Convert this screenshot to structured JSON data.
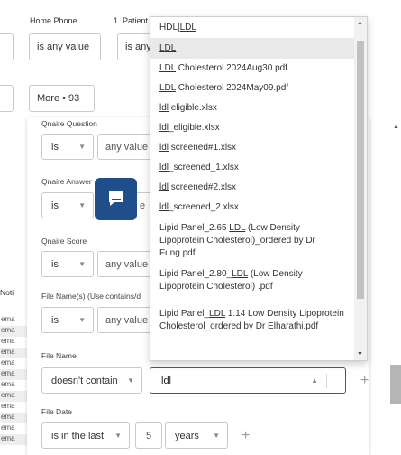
{
  "header": {
    "home_phone_label": "Home Phone",
    "patient_label": "1. Patient",
    "home_phone_value": "is any value",
    "patient_value": "is any",
    "more_button": "More • 93"
  },
  "filters": {
    "qnaire_question": {
      "label": "Qnaire Question",
      "op": "is",
      "value": "any value"
    },
    "qnaire_answer": {
      "label": "Qnaire Answer",
      "op": "is",
      "value": "e"
    },
    "qnaire_score": {
      "label": "Qnaire Score",
      "op": "is",
      "value": "any value"
    },
    "file_names": {
      "label": "File Name(s) (Use contains/d",
      "op": "is",
      "value": "any value"
    },
    "file_name": {
      "label": "File Name",
      "op": "doesn't contain",
      "value": "ldl"
    },
    "file_date": {
      "label": "File Date",
      "op": "is in the last",
      "number": "5",
      "unit": "years"
    }
  },
  "notifications": {
    "label": "Noti",
    "rows": [
      "ema",
      "ema",
      "ema",
      "ema",
      "ema",
      "ema",
      "ema",
      "ema",
      "ema",
      "ema",
      "ema",
      "ema"
    ]
  },
  "dropdown": {
    "items": [
      {
        "pre": "HDL|",
        "match": "LDL",
        "post": ""
      },
      {
        "pre": "",
        "match": "LDL",
        "post": ""
      },
      {
        "pre": "",
        "match": "LDL",
        "post": " Cholesterol 2024Aug30.pdf"
      },
      {
        "pre": "",
        "match": "LDL",
        "post": " Cholesterol 2024May09.pdf"
      },
      {
        "pre": "",
        "match": "ldl",
        "post": " eligible.xlsx"
      },
      {
        "pre": "",
        "match": "ldl",
        "post": "_eligible.xlsx"
      },
      {
        "pre": "",
        "match": "ldl",
        "post": " screened#1.xlsx"
      },
      {
        "pre": "",
        "match": "ldl",
        "post": "_screened_1.xlsx"
      },
      {
        "pre": "",
        "match": "ldl",
        "post": " screened#2.xlsx"
      },
      {
        "pre": "",
        "match": "ldl",
        "post": "_screened_2.xlsx"
      },
      {
        "pre": "Lipid Panel_2.65 ",
        "match": "LDL",
        "post": " (Low Density Lipoprotein Cholesterol)_ordered by Dr Fung.pdf"
      },
      {
        "pre": "Lipid Panel_2.80_",
        "match": "LDL",
        "post": " (Low Density Lipoprotein Cholesterol) .pdf"
      },
      {
        "pre": "Lipid Panel_",
        "match": "LDL",
        "post": " 1.14 Low Density Lipoprotein Cholesterol_ordered by Dr Elharathi.pdf"
      }
    ]
  },
  "colors": {
    "accent": "#1f4e8a",
    "focus_border": "#1f5fa8",
    "active_item": "#e9e9e9"
  },
  "icons": {
    "chat": "chat-bubble-icon",
    "caret": "caret-down-icon",
    "add": "plus-icon",
    "scroll_up": "scroll-up-icon",
    "scroll_down": "scroll-down-icon"
  }
}
